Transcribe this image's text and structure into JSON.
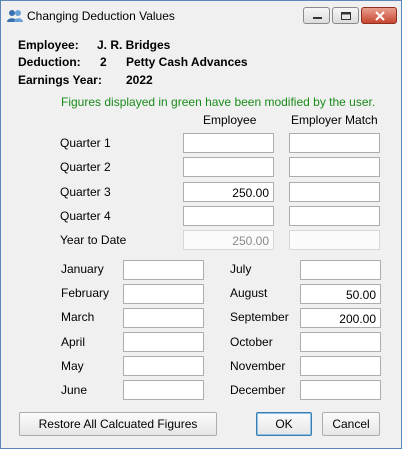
{
  "window": {
    "title": "Changing Deduction Values"
  },
  "header": {
    "employee_label": "Employee:",
    "employee_value": "J. R. Bridges",
    "deduction_label": "Deduction:",
    "deduction_num": "2",
    "deduction_name": "Petty Cash Advances",
    "year_label": "Earnings Year:",
    "year_value": "2022"
  },
  "note": "Figures displayed in green have been modified by the user.",
  "columns": {
    "employee": "Employee",
    "employer": "Employer Match"
  },
  "quarters": [
    {
      "label": "Quarter 1",
      "employee": "",
      "employer": ""
    },
    {
      "label": "Quarter 2",
      "employee": "",
      "employer": ""
    },
    {
      "label": "Quarter 3",
      "employee": "250.00",
      "employer": ""
    },
    {
      "label": "Quarter 4",
      "employee": "",
      "employer": ""
    }
  ],
  "ytd": {
    "label": "Year to Date",
    "employee": "250.00",
    "employer": ""
  },
  "months_left": [
    {
      "label": "January",
      "value": ""
    },
    {
      "label": "February",
      "value": ""
    },
    {
      "label": "March",
      "value": ""
    },
    {
      "label": "April",
      "value": ""
    },
    {
      "label": "May",
      "value": ""
    },
    {
      "label": "June",
      "value": ""
    }
  ],
  "months_right": [
    {
      "label": "July",
      "value": ""
    },
    {
      "label": "August",
      "value": "50.00"
    },
    {
      "label": "September",
      "value": "200.00"
    },
    {
      "label": "October",
      "value": ""
    },
    {
      "label": "November",
      "value": ""
    },
    {
      "label": "December",
      "value": ""
    }
  ],
  "buttons": {
    "restore": "Restore All Calcuated Figures",
    "ok": "OK",
    "cancel": "Cancel"
  },
  "icons": {
    "app": "users-icon",
    "minimize": "minimize-icon",
    "maximize": "maximize-icon",
    "close": "close-icon"
  },
  "colors": {
    "modified_text": "#1a8c1a",
    "disabled_text": "#8a8a8a"
  }
}
